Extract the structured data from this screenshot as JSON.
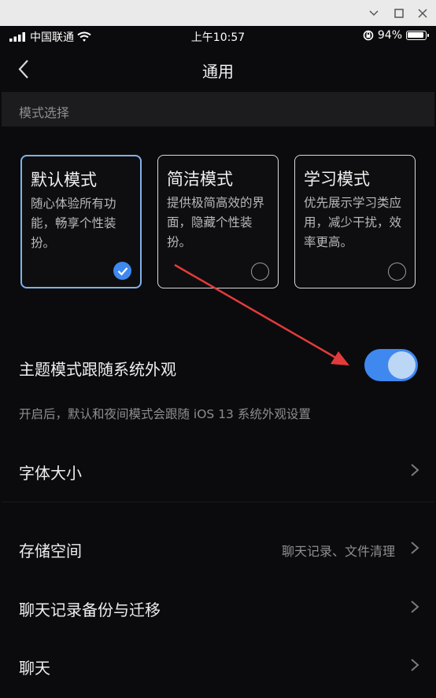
{
  "status_bar": {
    "carrier": "中国联通",
    "time": "上午10:57",
    "battery_percent": "94%",
    "battery_level": 0.94
  },
  "nav": {
    "title": "通用",
    "back_icon": "chevron-left-icon"
  },
  "mode_section": {
    "header": "模式选择",
    "modes": [
      {
        "title": "默认模式",
        "description": "随心体验所有功能，畅享个性装扮。",
        "selected": true
      },
      {
        "title": "简洁模式",
        "description": "提供极简高效的界面，隐藏个性装扮。",
        "selected": false
      },
      {
        "title": "学习模式",
        "description": "优先展示学习类应用，减少干扰，效率更高。",
        "selected": false
      }
    ]
  },
  "theme_follow": {
    "label": "主题模式跟随系统外观",
    "enabled": true,
    "hint": "开启后，默认和夜间模式会跟随 iOS 13 系统外观设置"
  },
  "settings_rows": [
    {
      "label": "字体大小",
      "value": ""
    },
    {
      "label": "存储空间",
      "value": "聊天记录、文件清理"
    },
    {
      "label": "聊天记录备份与迁移",
      "value": ""
    },
    {
      "label": "聊天",
      "value": ""
    }
  ],
  "colors": {
    "accent": "#3f88f0",
    "annotation_arrow": "#e23b3b",
    "background": "#0b0b0d"
  }
}
